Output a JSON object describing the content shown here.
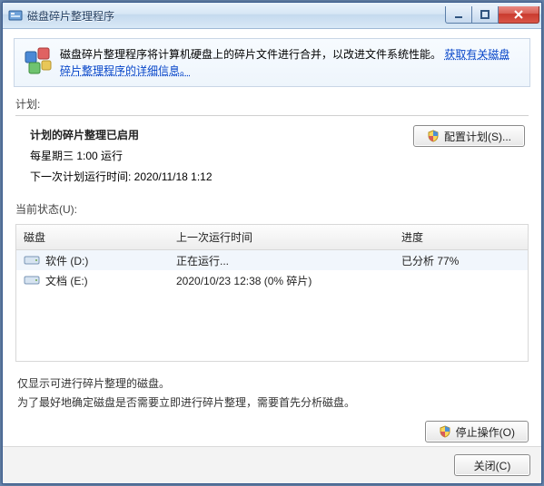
{
  "window": {
    "title": "磁盘碎片整理程序"
  },
  "banner": {
    "text_before_link": "磁盘碎片整理程序将计算机硬盘上的碎片文件进行合并，以改进文件系统性能。",
    "link_text": "获取有关磁盘碎片整理程序的详细信息。"
  },
  "plan": {
    "section_label": "计划:",
    "title": "计划的碎片整理已启用",
    "schedule": "每星期三  1:00 运行",
    "next_run": "下一次计划运行时间: 2020/11/18 1:12",
    "configure_btn": "配置计划(S)..."
  },
  "status": {
    "section_label": "当前状态(U):",
    "headers": {
      "disk": "磁盘",
      "last_run": "上一次运行时间",
      "progress": "进度"
    },
    "rows": [
      {
        "name": "软件 (D:)",
        "last_run": "正在运行...",
        "progress": "已分析 77%",
        "selected": true
      },
      {
        "name": "文档 (E:)",
        "last_run": "2020/10/23 12:38 (0% 碎片)",
        "progress": "",
        "selected": false
      }
    ]
  },
  "hint": {
    "line1": "仅显示可进行碎片整理的磁盘。",
    "line2": "为了最好地确定磁盘是否需要立即进行碎片整理，需要首先分析磁盘。"
  },
  "buttons": {
    "stop": "停止操作(O)",
    "close": "关闭(C)"
  }
}
